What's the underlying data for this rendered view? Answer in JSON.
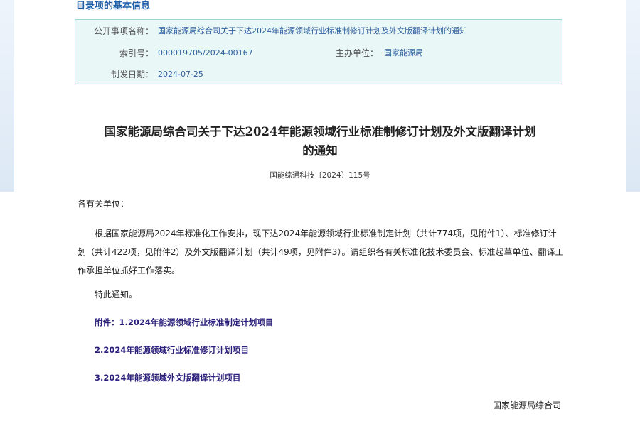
{
  "meta": {
    "heading": "目录项的基本信息",
    "public_item_label": "公开事项名称：",
    "public_item_value": "国家能源局综合司关于下达2024年能源领域行业标准制修订计划及外文版翻译计划的通知",
    "index_label": "索引号：",
    "index_value": "000019705/2024-00167",
    "host_label": "主办单位：",
    "host_value": "国家能源局",
    "date_label": "制发日期：",
    "date_value": "2024-07-25"
  },
  "document": {
    "title_line1": "国家能源局综合司关于下达2024年能源领域行业标准制修订计划及外文版翻译计划",
    "title_line2": "的通知",
    "doc_number": "国能综通科技〔2024〕115号",
    "salutation": "各有关单位：",
    "body": "根据国家能源局2024年标准化工作安排，现下达2024年能源领域行业标准制定计划（共计774项，见附件1）、标准修订计划（共计422项，见附件2）及外文版翻译计划（共计49项，见附件3）。请组织各有关标准化技术委员会、标准起草单位、翻译工作承担单位抓好工作落实。",
    "closing": "特此通知。",
    "attachments": [
      "附件：1.2024年能源领域行业标准制定计划项目",
      "2.2024年能源领域行业标准修订计划项目",
      "3.2024年能源领域外文版翻译计划项目"
    ],
    "signature": "国家能源局综合司"
  },
  "colors": {
    "heading_blue": "#1f5fa8",
    "meta_box_bg": "#eaf7f7",
    "meta_box_border": "#9fd3d6",
    "meta_value_blue": "#2d5f9e",
    "attachment_link": "#2a1f7a"
  }
}
